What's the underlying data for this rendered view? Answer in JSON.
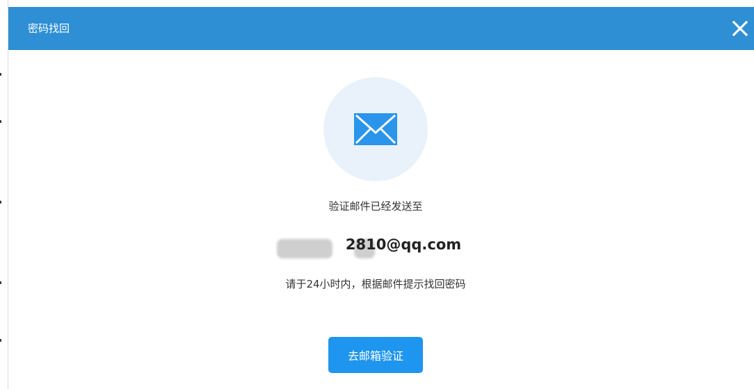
{
  "dialog": {
    "title": "密码找回",
    "close_icon": "close-icon",
    "mail_icon": "envelope-icon",
    "sent_label": "验证邮件已经发送至",
    "email": "2810@qq.com",
    "hint": "请于24小时内，根据邮件提示找回密码",
    "button_label": "去邮箱验证"
  },
  "colors": {
    "titlebar": "#2e8fd4",
    "icon_circle": "#e9f2fa",
    "icon": "#2a95ea",
    "button": "#1e95ee"
  }
}
